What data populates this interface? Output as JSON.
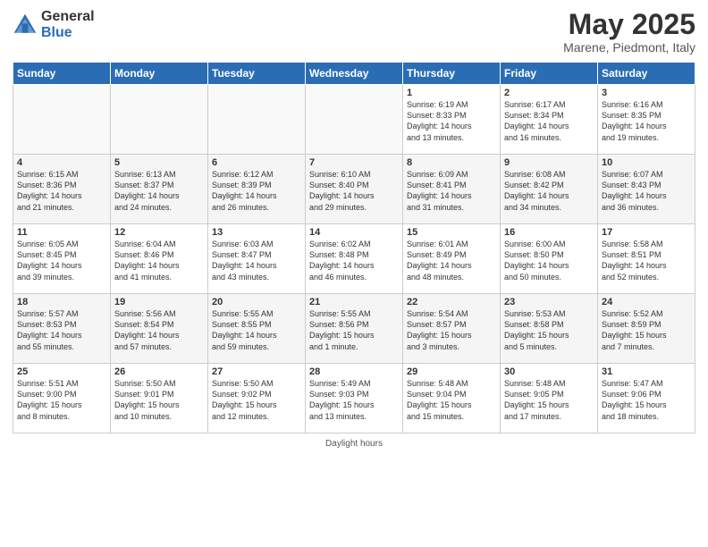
{
  "header": {
    "logo_general": "General",
    "logo_blue": "Blue",
    "month_title": "May 2025",
    "subtitle": "Marene, Piedmont, Italy"
  },
  "footer": {
    "text": "Daylight hours"
  },
  "weekdays": [
    "Sunday",
    "Monday",
    "Tuesday",
    "Wednesday",
    "Thursday",
    "Friday",
    "Saturday"
  ],
  "weeks": [
    [
      {
        "day": "",
        "info": ""
      },
      {
        "day": "",
        "info": ""
      },
      {
        "day": "",
        "info": ""
      },
      {
        "day": "",
        "info": ""
      },
      {
        "day": "1",
        "info": "Sunrise: 6:19 AM\nSunset: 8:33 PM\nDaylight: 14 hours\nand 13 minutes."
      },
      {
        "day": "2",
        "info": "Sunrise: 6:17 AM\nSunset: 8:34 PM\nDaylight: 14 hours\nand 16 minutes."
      },
      {
        "day": "3",
        "info": "Sunrise: 6:16 AM\nSunset: 8:35 PM\nDaylight: 14 hours\nand 19 minutes."
      }
    ],
    [
      {
        "day": "4",
        "info": "Sunrise: 6:15 AM\nSunset: 8:36 PM\nDaylight: 14 hours\nand 21 minutes."
      },
      {
        "day": "5",
        "info": "Sunrise: 6:13 AM\nSunset: 8:37 PM\nDaylight: 14 hours\nand 24 minutes."
      },
      {
        "day": "6",
        "info": "Sunrise: 6:12 AM\nSunset: 8:39 PM\nDaylight: 14 hours\nand 26 minutes."
      },
      {
        "day": "7",
        "info": "Sunrise: 6:10 AM\nSunset: 8:40 PM\nDaylight: 14 hours\nand 29 minutes."
      },
      {
        "day": "8",
        "info": "Sunrise: 6:09 AM\nSunset: 8:41 PM\nDaylight: 14 hours\nand 31 minutes."
      },
      {
        "day": "9",
        "info": "Sunrise: 6:08 AM\nSunset: 8:42 PM\nDaylight: 14 hours\nand 34 minutes."
      },
      {
        "day": "10",
        "info": "Sunrise: 6:07 AM\nSunset: 8:43 PM\nDaylight: 14 hours\nand 36 minutes."
      }
    ],
    [
      {
        "day": "11",
        "info": "Sunrise: 6:05 AM\nSunset: 8:45 PM\nDaylight: 14 hours\nand 39 minutes."
      },
      {
        "day": "12",
        "info": "Sunrise: 6:04 AM\nSunset: 8:46 PM\nDaylight: 14 hours\nand 41 minutes."
      },
      {
        "day": "13",
        "info": "Sunrise: 6:03 AM\nSunset: 8:47 PM\nDaylight: 14 hours\nand 43 minutes."
      },
      {
        "day": "14",
        "info": "Sunrise: 6:02 AM\nSunset: 8:48 PM\nDaylight: 14 hours\nand 46 minutes."
      },
      {
        "day": "15",
        "info": "Sunrise: 6:01 AM\nSunset: 8:49 PM\nDaylight: 14 hours\nand 48 minutes."
      },
      {
        "day": "16",
        "info": "Sunrise: 6:00 AM\nSunset: 8:50 PM\nDaylight: 14 hours\nand 50 minutes."
      },
      {
        "day": "17",
        "info": "Sunrise: 5:58 AM\nSunset: 8:51 PM\nDaylight: 14 hours\nand 52 minutes."
      }
    ],
    [
      {
        "day": "18",
        "info": "Sunrise: 5:57 AM\nSunset: 8:53 PM\nDaylight: 14 hours\nand 55 minutes."
      },
      {
        "day": "19",
        "info": "Sunrise: 5:56 AM\nSunset: 8:54 PM\nDaylight: 14 hours\nand 57 minutes."
      },
      {
        "day": "20",
        "info": "Sunrise: 5:55 AM\nSunset: 8:55 PM\nDaylight: 14 hours\nand 59 minutes."
      },
      {
        "day": "21",
        "info": "Sunrise: 5:55 AM\nSunset: 8:56 PM\nDaylight: 15 hours\nand 1 minute."
      },
      {
        "day": "22",
        "info": "Sunrise: 5:54 AM\nSunset: 8:57 PM\nDaylight: 15 hours\nand 3 minutes."
      },
      {
        "day": "23",
        "info": "Sunrise: 5:53 AM\nSunset: 8:58 PM\nDaylight: 15 hours\nand 5 minutes."
      },
      {
        "day": "24",
        "info": "Sunrise: 5:52 AM\nSunset: 8:59 PM\nDaylight: 15 hours\nand 7 minutes."
      }
    ],
    [
      {
        "day": "25",
        "info": "Sunrise: 5:51 AM\nSunset: 9:00 PM\nDaylight: 15 hours\nand 8 minutes."
      },
      {
        "day": "26",
        "info": "Sunrise: 5:50 AM\nSunset: 9:01 PM\nDaylight: 15 hours\nand 10 minutes."
      },
      {
        "day": "27",
        "info": "Sunrise: 5:50 AM\nSunset: 9:02 PM\nDaylight: 15 hours\nand 12 minutes."
      },
      {
        "day": "28",
        "info": "Sunrise: 5:49 AM\nSunset: 9:03 PM\nDaylight: 15 hours\nand 13 minutes."
      },
      {
        "day": "29",
        "info": "Sunrise: 5:48 AM\nSunset: 9:04 PM\nDaylight: 15 hours\nand 15 minutes."
      },
      {
        "day": "30",
        "info": "Sunrise: 5:48 AM\nSunset: 9:05 PM\nDaylight: 15 hours\nand 17 minutes."
      },
      {
        "day": "31",
        "info": "Sunrise: 5:47 AM\nSunset: 9:06 PM\nDaylight: 15 hours\nand 18 minutes."
      }
    ]
  ]
}
